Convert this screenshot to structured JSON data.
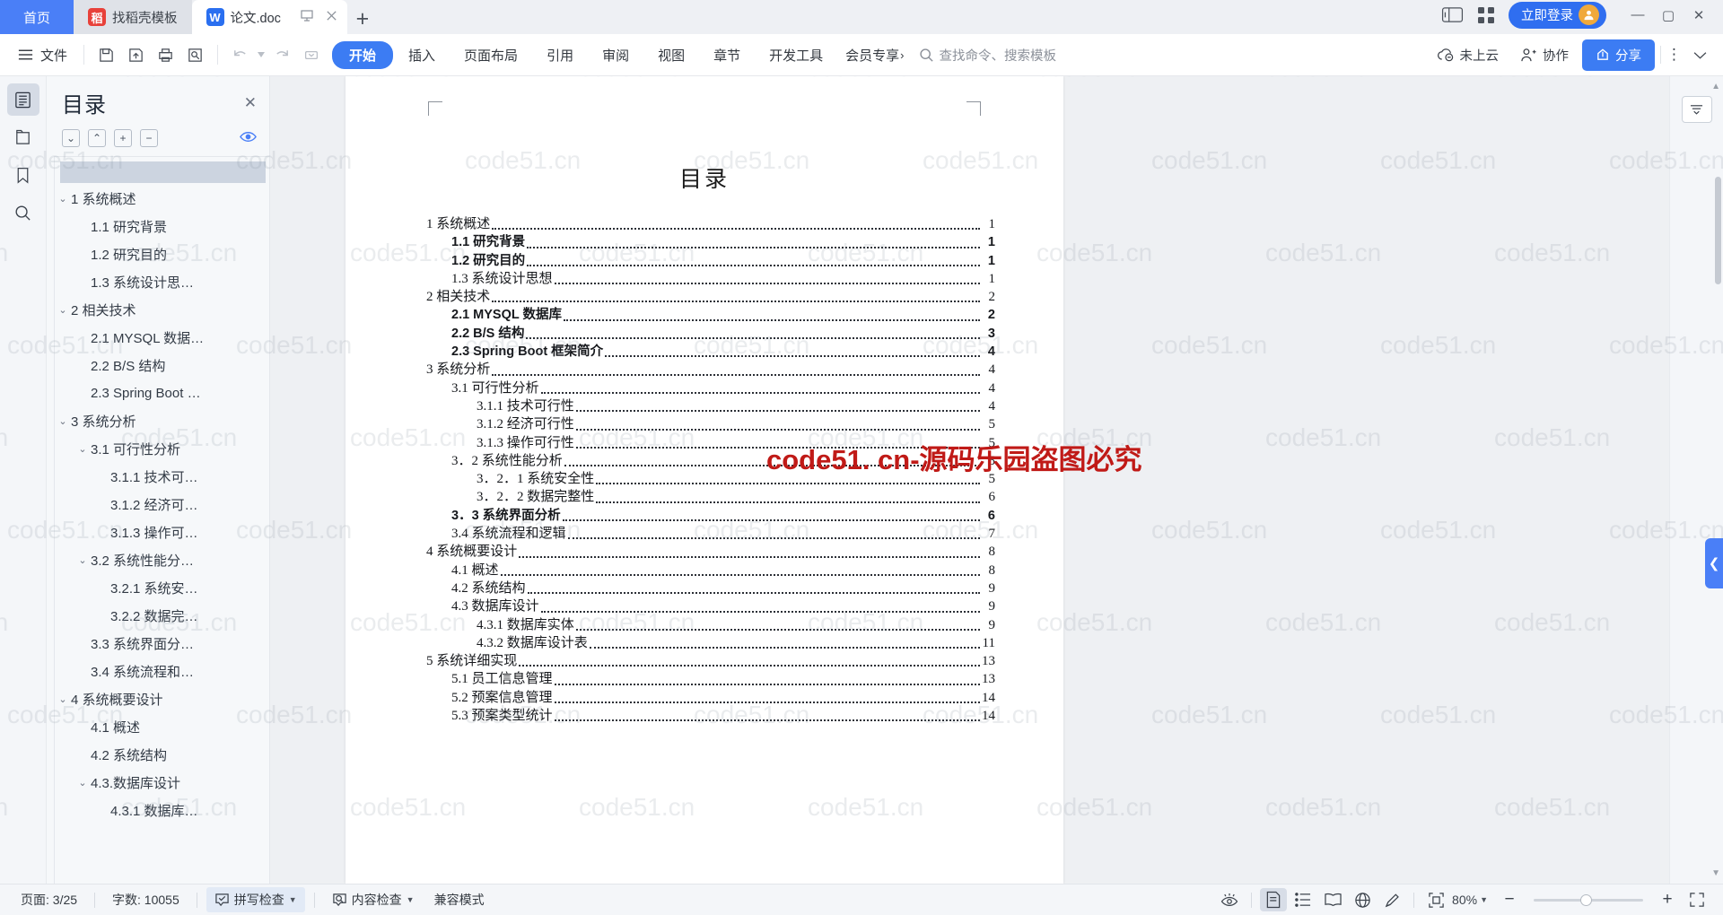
{
  "window": {
    "tabs": [
      {
        "label": "首页",
        "icon": "home-tab",
        "type": "home"
      },
      {
        "label": "找稻壳模板",
        "icon": "docer-icon",
        "type": "template"
      },
      {
        "label": "论文.doc",
        "icon": "wps-writer-icon",
        "type": "document",
        "active": true
      }
    ],
    "new_tab_label": "+",
    "login_label": "立即登录",
    "minimize": "—",
    "maximize": "▢",
    "close": "✕"
  },
  "ribbon": {
    "file_label": "文件",
    "quick_icons": [
      "save-icon",
      "save-as-icon",
      "print-icon",
      "print-preview-icon",
      "undo-icon",
      "redo-icon",
      "customize-icon"
    ],
    "tabs": [
      {
        "label": "开始",
        "selected": true
      },
      {
        "label": "插入",
        "selected": false
      },
      {
        "label": "页面布局",
        "selected": false
      },
      {
        "label": "引用",
        "selected": false
      },
      {
        "label": "审阅",
        "selected": false
      },
      {
        "label": "视图",
        "selected": false
      },
      {
        "label": "章节",
        "selected": false
      },
      {
        "label": "开发工具",
        "selected": false
      }
    ],
    "vip_label": "会员专享",
    "search_placeholder": "查找命令、搜索模板",
    "cloud_label": "未上云",
    "collab_label": "协作",
    "share_label": "分享",
    "more_label": "⋮"
  },
  "left_rail": {
    "items": [
      {
        "name": "outline-view",
        "icon": "document-outline-icon",
        "active": true
      },
      {
        "name": "thumbnail-view",
        "icon": "page-thumbnail-icon",
        "active": false
      },
      {
        "name": "bookmark-view",
        "icon": "bookmark-icon",
        "active": false
      },
      {
        "name": "search-view",
        "icon": "search-icon",
        "active": false
      }
    ]
  },
  "outline_panel": {
    "title": "目录",
    "close_label": "✕",
    "tools": [
      {
        "name": "expand-all-button",
        "glyph": "⌄"
      },
      {
        "name": "collapse-all-button",
        "glyph": "⌃"
      },
      {
        "name": "increase-level-button",
        "glyph": "+"
      },
      {
        "name": "decrease-level-button",
        "glyph": "−"
      }
    ],
    "eye_label": "👁",
    "items": [
      {
        "text": "1 系统概述",
        "indent": 0,
        "caret": "⌄"
      },
      {
        "text": "1.1  研究背景",
        "indent": 1,
        "caret": ""
      },
      {
        "text": "1.2 研究目的",
        "indent": 1,
        "caret": ""
      },
      {
        "text": "1.3 系统设计思…",
        "indent": 1,
        "caret": ""
      },
      {
        "text": "2 相关技术",
        "indent": 0,
        "caret": "⌄"
      },
      {
        "text": "2.1 MYSQL 数据…",
        "indent": 1,
        "caret": ""
      },
      {
        "text": "2.2 B/S 结构",
        "indent": 1,
        "caret": ""
      },
      {
        "text": "2.3 Spring Boot …",
        "indent": 1,
        "caret": ""
      },
      {
        "text": "3 系统分析",
        "indent": 0,
        "caret": "⌄"
      },
      {
        "text": "3.1 可行性分析",
        "indent": 1,
        "caret": "⌄"
      },
      {
        "text": "3.1.1 技术可…",
        "indent": 2,
        "caret": ""
      },
      {
        "text": "3.1.2 经济可…",
        "indent": 2,
        "caret": ""
      },
      {
        "text": "3.1.3 操作可…",
        "indent": 2,
        "caret": ""
      },
      {
        "text": "3.2 系统性能分…",
        "indent": 1,
        "caret": "⌄"
      },
      {
        "text": "3.2.1 系统安…",
        "indent": 2,
        "caret": ""
      },
      {
        "text": "3.2.2  数据完…",
        "indent": 2,
        "caret": ""
      },
      {
        "text": "3.3 系统界面分…",
        "indent": 1,
        "caret": ""
      },
      {
        "text": "3.4 系统流程和…",
        "indent": 1,
        "caret": ""
      },
      {
        "text": "4 系统概要设计",
        "indent": 0,
        "caret": "⌄"
      },
      {
        "text": "4.1 概述",
        "indent": 1,
        "caret": ""
      },
      {
        "text": "4.2 系统结构",
        "indent": 1,
        "caret": ""
      },
      {
        "text": "4.3.数据库设计",
        "indent": 1,
        "caret": "⌄"
      },
      {
        "text": "4.3.1 数据库…",
        "indent": 2,
        "caret": ""
      }
    ]
  },
  "document": {
    "heading": "目录",
    "toc": [
      {
        "label": "1 系统概述",
        "page": "1",
        "indent": 0,
        "bold": false
      },
      {
        "label": "1.1  研究背景",
        "page": "1",
        "indent": 1,
        "bold": true
      },
      {
        "label": "1.2 研究目的",
        "page": "1",
        "indent": 1,
        "bold": true
      },
      {
        "label": "1.3 系统设计思想",
        "page": "1",
        "indent": 1,
        "bold": false
      },
      {
        "label": "2 相关技术",
        "page": "2",
        "indent": 0,
        "bold": false
      },
      {
        "label": "2.1 MYSQL 数据库",
        "page": "2",
        "indent": 1,
        "bold": true
      },
      {
        "label": "2.2 B/S 结构",
        "page": "3",
        "indent": 1,
        "bold": true
      },
      {
        "label": "2.3 Spring Boot 框架简介",
        "page": "4",
        "indent": 1,
        "bold": true
      },
      {
        "label": "3 系统分析",
        "page": "4",
        "indent": 0,
        "bold": false
      },
      {
        "label": "3.1 可行性分析",
        "page": "4",
        "indent": 1,
        "bold": false
      },
      {
        "label": "3.1.1 技术可行性",
        "page": "4",
        "indent": 2,
        "bold": false
      },
      {
        "label": "3.1.2 经济可行性",
        "page": "5",
        "indent": 2,
        "bold": false
      },
      {
        "label": "3.1.3 操作可行性",
        "page": "5",
        "indent": 2,
        "bold": false
      },
      {
        "label": "3．2 系统性能分析",
        "page": "5",
        "indent": 1,
        "bold": false
      },
      {
        "label": "3．2．1  系统安全性",
        "page": "5",
        "indent": 2,
        "bold": false
      },
      {
        "label": "3．2．2  数据完整性",
        "page": "6",
        "indent": 2,
        "bold": false
      },
      {
        "label": "3．3 系统界面分析",
        "page": "6",
        "indent": 1,
        "bold": true
      },
      {
        "label": "3.4 系统流程和逻辑",
        "page": "7",
        "indent": 1,
        "bold": false
      },
      {
        "label": "4 系统概要设计",
        "page": "8",
        "indent": 0,
        "bold": false
      },
      {
        "label": "4.1 概述",
        "page": "8",
        "indent": 1,
        "bold": false
      },
      {
        "label": "4.2 系统结构",
        "page": "9",
        "indent": 1,
        "bold": false
      },
      {
        "label": "4.3 数据库设计",
        "page": "9",
        "indent": 1,
        "bold": false
      },
      {
        "label": "4.3.1 数据库实体",
        "page": "9",
        "indent": 2,
        "bold": false
      },
      {
        "label": "4.3.2 数据库设计表",
        "page": "11",
        "indent": 2,
        "bold": false
      },
      {
        "label": "5 系统详细实现",
        "page": "13",
        "indent": 0,
        "bold": false
      },
      {
        "label": "5.1  员工信息管理",
        "page": "13",
        "indent": 1,
        "bold": false
      },
      {
        "label": "5.2  预案信息管理",
        "page": "14",
        "indent": 1,
        "bold": false
      },
      {
        "label": "5.3  预案类型统计",
        "page": "14",
        "indent": 1,
        "bold": false
      }
    ],
    "red_watermark": "code51. cn-源码乐园盗图必究",
    "watermark_text": "code51.cn"
  },
  "right_rail": {
    "button_icon": "style-pane-icon",
    "collapse_glyph": "❮"
  },
  "status_bar": {
    "page_label": "页面: 3/25",
    "word_count_label": "字数: 10055",
    "spell_check_label": "拼写检查",
    "content_check_label": "内容检查",
    "compat_label": "兼容模式",
    "view_icons": [
      {
        "name": "focus-eye-icon",
        "active": false
      },
      {
        "name": "page-view-icon",
        "active": true
      },
      {
        "name": "outline-view-icon",
        "active": false
      },
      {
        "name": "read-view-icon",
        "active": false
      },
      {
        "name": "web-view-icon",
        "active": false
      },
      {
        "name": "ink-view-icon",
        "active": false
      },
      {
        "name": "fit-page-icon",
        "active": false
      }
    ],
    "zoom_label": "80%",
    "zoom_out": "−",
    "zoom_in": "+",
    "fullscreen_icon": "fullscreen-icon"
  }
}
